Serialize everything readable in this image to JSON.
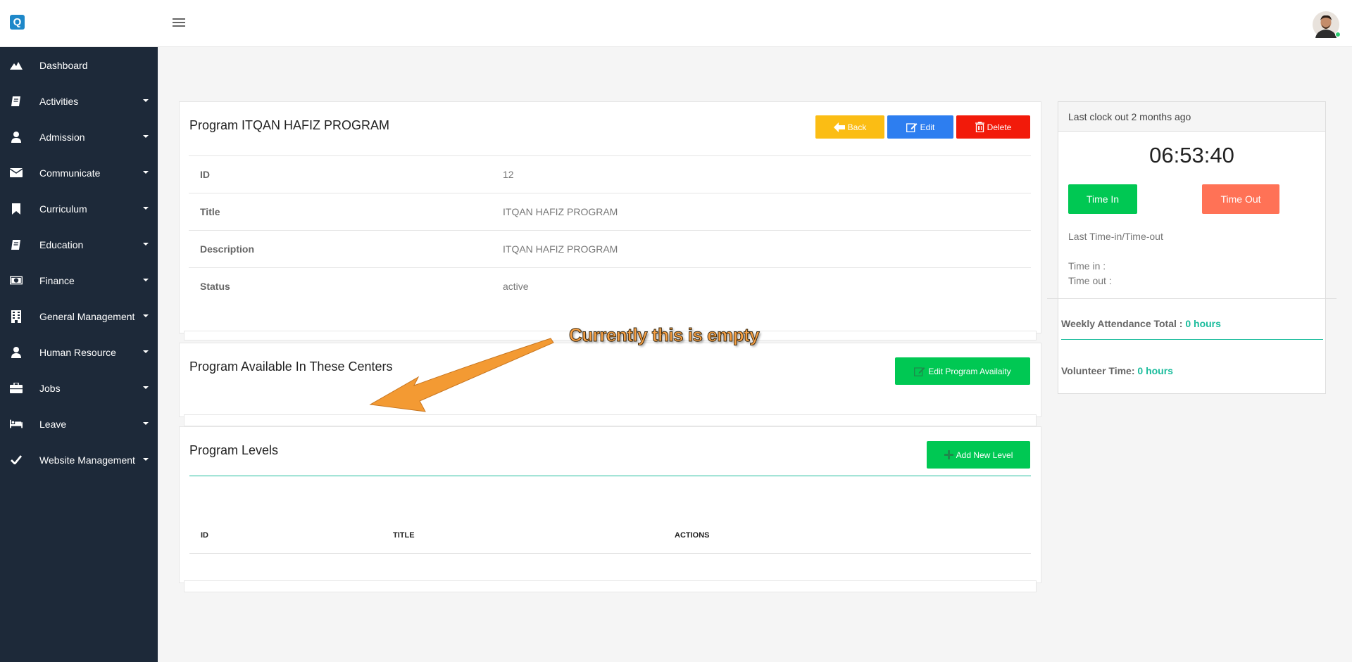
{
  "app": {
    "logo_letter": "Q"
  },
  "sidebar": {
    "items": [
      {
        "label": "Dashboard",
        "icon": "dashboard-icon",
        "caret": false
      },
      {
        "label": "Activities",
        "icon": "book-icon",
        "caret": true
      },
      {
        "label": "Admission",
        "icon": "user-icon",
        "caret": true
      },
      {
        "label": "Communicate",
        "icon": "envelope-icon",
        "caret": true
      },
      {
        "label": "Curriculum",
        "icon": "bookmark-icon",
        "caret": true
      },
      {
        "label": "Education",
        "icon": "book-icon",
        "caret": true
      },
      {
        "label": "Finance",
        "icon": "money-icon",
        "caret": true
      },
      {
        "label": "General Management",
        "icon": "building-icon",
        "caret": true
      },
      {
        "label": "Human Resource",
        "icon": "user-icon",
        "caret": true
      },
      {
        "label": "Jobs",
        "icon": "briefcase-icon",
        "caret": true
      },
      {
        "label": "Leave",
        "icon": "bed-icon",
        "caret": true
      },
      {
        "label": "Website Management",
        "icon": "check-icon",
        "caret": true
      }
    ]
  },
  "program": {
    "title": "Program ITQAN HAFIZ PROGRAM",
    "back_label": "Back",
    "edit_label": "Edit",
    "delete_label": "Delete",
    "details": [
      {
        "key": "ID",
        "value": "12"
      },
      {
        "key": "Title",
        "value": "ITQAN HAFIZ PROGRAM"
      },
      {
        "key": "Description",
        "value": "ITQAN HAFIZ PROGRAM"
      },
      {
        "key": "Status",
        "value": "active"
      }
    ]
  },
  "centers": {
    "title": "Program Available In These Centers",
    "edit_label": "Edit Program Availaity"
  },
  "levels": {
    "title": "Program Levels",
    "add_label": "Add New Level",
    "columns": [
      "ID",
      "TITLE",
      "ACTIONS"
    ]
  },
  "annotation": {
    "text": "Currently this is empty"
  },
  "attendance": {
    "header": "Last clock out 2 months ago",
    "clock": "06:53:40",
    "time_in_label": "Time In",
    "time_out_label": "Time Out",
    "last_label": "Last Time-in/Time-out",
    "time_in_text": "Time in :",
    "time_out_text": "Time out :",
    "weekly_label": "Weekly Attendance Total :",
    "weekly_value": "0 hours",
    "volunteer_label": "Volunteer Time:",
    "volunteer_value": "0 hours"
  },
  "colors": {
    "sidebar_bg": "#1d2939",
    "back": "#fbbd14",
    "edit": "#2d7ef0",
    "delete": "#f21a0a",
    "green": "#00c853",
    "time_out": "#ff7256",
    "accent": "#1abc9c",
    "annotation": "#f7a045"
  }
}
